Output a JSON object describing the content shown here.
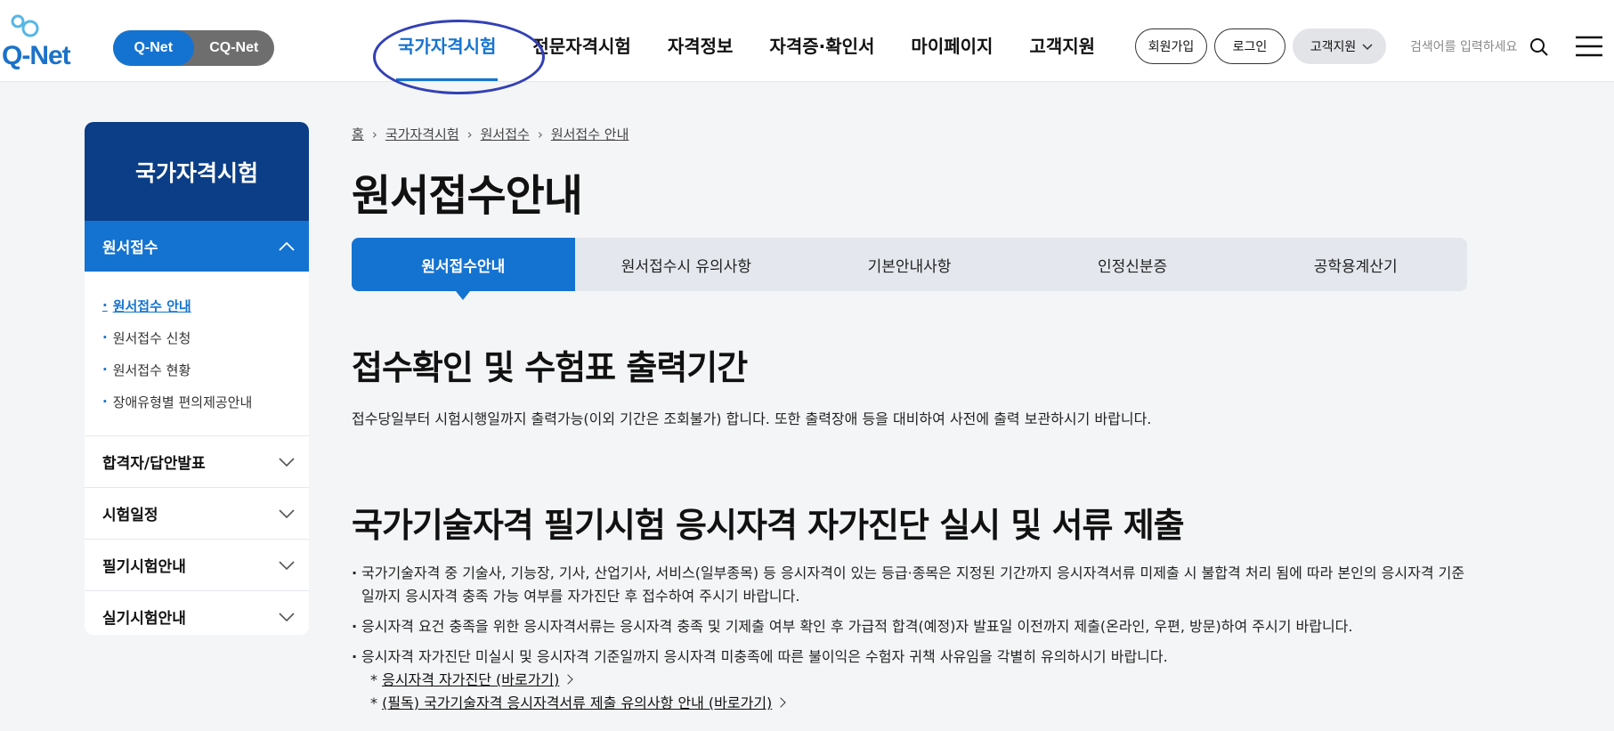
{
  "header": {
    "logo_text": "Q-Net",
    "site_toggle": [
      "Q-Net",
      "CQ-Net"
    ],
    "gnb": [
      "국가자격시험",
      "전문자격시험",
      "자격정보",
      "자격증·확인서",
      "마이페이지",
      "고객지원"
    ],
    "join_label": "회원가입",
    "login_label": "로그인",
    "support_label": "고객지원",
    "search_placeholder": "검색어를 입력하세요"
  },
  "lnb": {
    "title": "국가자격시험",
    "open_item": "원서접수",
    "sub_items": [
      "원서접수 안내",
      "원서접수 신청",
      "원서접수 현황",
      "장애유형별 편의제공안내"
    ],
    "items": [
      "합격자/답안발표",
      "시험일정",
      "필기시험안내",
      "실기시험안내"
    ]
  },
  "breadcrumb": [
    "홈",
    "국가자격시험",
    "원서접수",
    "원서접수 안내"
  ],
  "page_title": "원서접수안내",
  "tabs": [
    "원서접수안내",
    "원서접수시 유의사항",
    "기본안내사항",
    "인정신분증",
    "공학용계산기"
  ],
  "section1": {
    "heading": "접수확인 및 수험표 출력기간",
    "text": "접수당일부터 시험시행일까지 출력가능(이외 기간은 조회불가) 합니다. 또한 출력장애 등을 대비하여 사전에 출력 보관하시기 바랍니다."
  },
  "section2": {
    "heading": "국가기술자격 필기시험 응시자격 자가진단 실시 및 서류 제출",
    "bullets": [
      "국가기술자격 중 기술사, 기능장, 기사, 산업기사, 서비스(일부종목) 등 응시자격이 있는 등급·종목은 지정된 기간까지 응시자격서류 미제출 시 불합격 처리 됨에 따라 본인의 응시자격 기준일까지 응시자격 충족 가능 여부를 자가진단 후 접수하여 주시기 바랍니다.",
      "응시자격 요건 충족을 위한 응시자격서류는 응시자격 충족 및 기제출 여부 확인 후 가급적 합격(예정)자 발표일 이전까지 제출(온라인, 우편, 방문)하여 주시기 바랍니다.",
      "응시자격 자가진단 미실시 및 응시자격 기준일까지 응시자격 미충족에 따른 불이익은 수험자 귀책 사유임을 각별히 유의하시기 바랍니다."
    ],
    "link1_prefix": "*",
    "link1": "응시자격 자가진단 (바로가기)",
    "link2_prefix": "*",
    "link2": "(필독) 국가기술자격 응시자격서류 제출 유의사항 안내 (바로가기)"
  },
  "colors": {
    "primary": "#1473d1",
    "navy": "#0b3e86",
    "annotation": "#3340b5"
  }
}
